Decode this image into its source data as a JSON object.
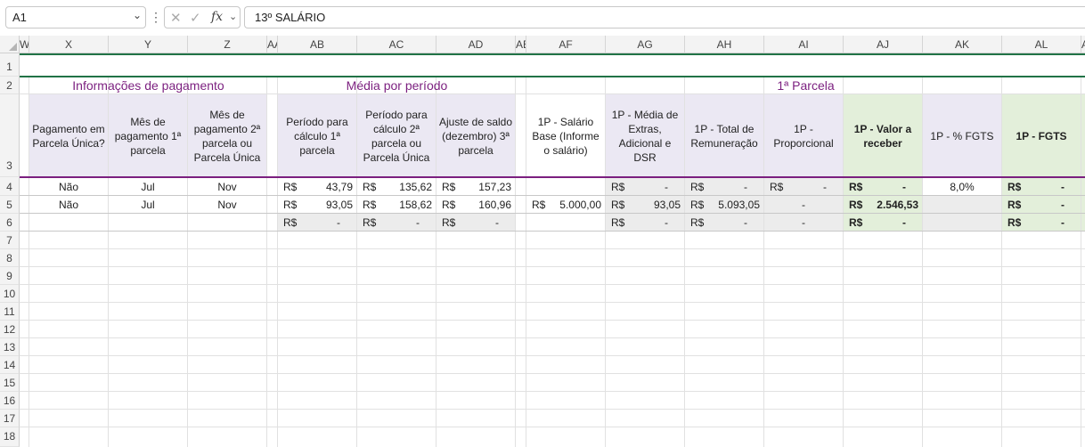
{
  "formula_bar": {
    "name_box": "A1",
    "formula": "13º SALÁRIO"
  },
  "columns": [
    "W",
    "X",
    "Y",
    "Z",
    "AA",
    "AB",
    "AC",
    "AD",
    "AE",
    "AF",
    "AG",
    "AH",
    "AI",
    "AJ",
    "AK",
    "AL",
    "A"
  ],
  "rows": [
    "1",
    "2",
    "3",
    "4",
    "5",
    "6",
    "7",
    "8",
    "9",
    "10",
    "11",
    "12",
    "13",
    "14",
    "15",
    "16",
    "17",
    "18"
  ],
  "sections": {
    "info": "Informações de pagamento",
    "media": "Média por período",
    "parcela": "1ª Parcela"
  },
  "headers": {
    "x": "Pagamento em Parcela Única?",
    "y": "Mês de pagamento 1ª parcela",
    "z": "Mês de pagamento 2ª parcela ou Parcela Única",
    "ab": "Período para cálculo 1ª parcela",
    "ac": "Período para cálculo 2ª parcela ou Parcela Única",
    "ad": "Ajuste de saldo (dezembro) 3ª parcela",
    "af": "1P - Salário Base (Informe o salário)",
    "ag": "1P - Média de Extras, Adicional e DSR",
    "ah": "1P - Total de Remuneração",
    "ai": "1P - Proporcional",
    "aj": "1P - Valor a receber",
    "ak": "1P - % FGTS",
    "al": "1P - FGTS"
  },
  "currency": "R$",
  "data_rows": [
    {
      "x": "Não",
      "y": "Jul",
      "z": "Nov",
      "ab": "43,79",
      "ac": "135,62",
      "ad": "157,23",
      "af": "",
      "ag": "-",
      "ah": "-",
      "ai_cur": "R$",
      "ai": "-",
      "aj": "-",
      "ak": "8,0%",
      "al": "-"
    },
    {
      "x": "Não",
      "y": "Jul",
      "z": "Nov",
      "ab": "93,05",
      "ac": "158,62",
      "ad": "160,96",
      "af": "5.000,00",
      "ag": "93,05",
      "ah": "5.093,05",
      "ai_cur": "",
      "ai": "-",
      "aj": "2.546,53",
      "ak": "",
      "al": "-"
    },
    {
      "x": "",
      "y": "",
      "z": "",
      "ab": "-",
      "ac": "-",
      "ad": "-",
      "af": "",
      "ag": "-",
      "ah": "-",
      "ai_cur": "",
      "ai": "-",
      "aj": "-",
      "ak": "",
      "al": "-"
    }
  ],
  "colors": {
    "section_text": "#7b1f7f",
    "header_lavender": "#ebe8f3",
    "highlight_green": "#e3efda",
    "grey_fill": "#ececec",
    "border_green": "#217346",
    "border_purple": "#7b1f7f"
  }
}
